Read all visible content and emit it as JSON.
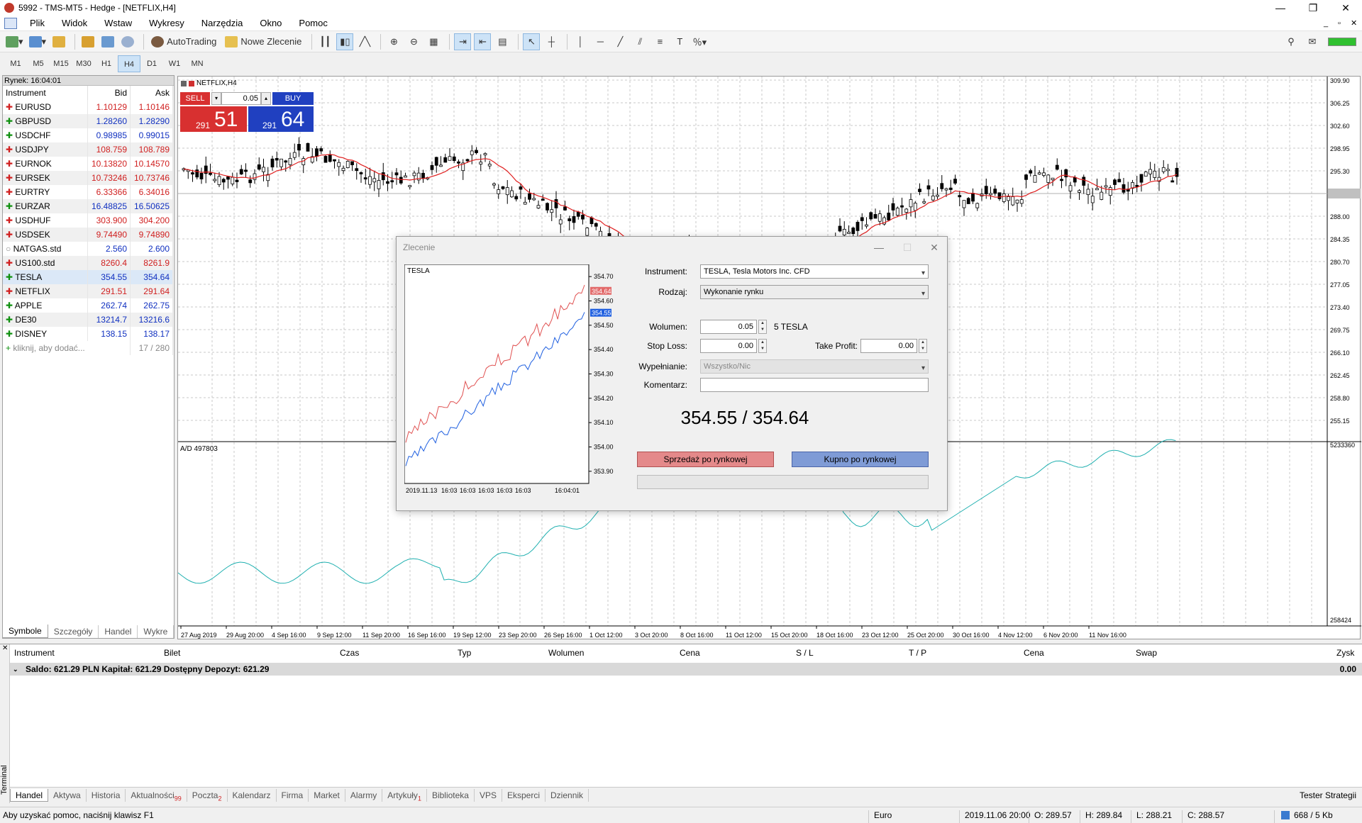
{
  "window": {
    "title": "5992 - TMS-MT5 - Hedge - [NETFLIX,H4]",
    "controls": [
      "—",
      "❐",
      "✕"
    ],
    "mdi_controls": [
      "_",
      "▫",
      "✕"
    ]
  },
  "menu": [
    "Plik",
    "Widok",
    "Wstaw",
    "Wykresy",
    "Narzędzia",
    "Okno",
    "Pomoc"
  ],
  "toolbar": {
    "autotrading": "AutoTrading",
    "new_order": "Nowe Zlecenie"
  },
  "timeframes": {
    "items": [
      "M1",
      "M5",
      "M15",
      "M30",
      "H1",
      "H4",
      "D1",
      "W1",
      "MN"
    ],
    "selected": "H4"
  },
  "market_watch": {
    "title": "Rynek: 16:04:01",
    "columns": [
      "Instrument",
      "Bid",
      "Ask"
    ],
    "rows": [
      {
        "symbol": "EURUSD",
        "bid": "1.10129",
        "ask": "1.10146",
        "dir": "down"
      },
      {
        "symbol": "GBPUSD",
        "bid": "1.28260",
        "ask": "1.28290",
        "dir": "up"
      },
      {
        "symbol": "USDCHF",
        "bid": "0.98985",
        "ask": "0.99015",
        "dir": "up"
      },
      {
        "symbol": "USDJPY",
        "bid": "108.759",
        "ask": "108.789",
        "dir": "down"
      },
      {
        "symbol": "EURNOK",
        "bid": "10.13820",
        "ask": "10.14570",
        "dir": "down"
      },
      {
        "symbol": "EURSEK",
        "bid": "10.73246",
        "ask": "10.73746",
        "dir": "down"
      },
      {
        "symbol": "EURTRY",
        "bid": "6.33366",
        "ask": "6.34016",
        "dir": "down"
      },
      {
        "symbol": "EURZAR",
        "bid": "16.48825",
        "ask": "16.50625",
        "dir": "up"
      },
      {
        "symbol": "USDHUF",
        "bid": "303.900",
        "ask": "304.200",
        "dir": "down"
      },
      {
        "symbol": "USDSEK",
        "bid": "9.74490",
        "ask": "9.74890",
        "dir": "down"
      },
      {
        "symbol": "NATGAS.std",
        "bid": "2.560",
        "ask": "2.600",
        "dir": "none"
      },
      {
        "symbol": "US100.std",
        "bid": "8260.4",
        "ask": "8261.9",
        "dir": "down"
      },
      {
        "symbol": "TESLA",
        "bid": "354.55",
        "ask": "354.64",
        "dir": "up"
      },
      {
        "symbol": "NETFLIX",
        "bid": "291.51",
        "ask": "291.64",
        "dir": "down"
      },
      {
        "symbol": "APPLE",
        "bid": "262.74",
        "ask": "262.75",
        "dir": "up"
      },
      {
        "symbol": "DE30",
        "bid": "13214.7",
        "ask": "13216.6",
        "dir": "up"
      },
      {
        "symbol": "DISNEY",
        "bid": "138.15",
        "ask": "138.17",
        "dir": "up"
      }
    ],
    "add_label": "kliknij, aby dodać...",
    "count": "17 / 280",
    "tabs": [
      "Symbole",
      "Szczegóły",
      "Handel",
      "Wykre"
    ]
  },
  "chart": {
    "label": "NETFLIX,H4",
    "oneclick": {
      "sell": "SELL",
      "buy": "BUY",
      "volume": "0.05",
      "sell_big": "51",
      "sell_small": "291",
      "buy_big": "64",
      "buy_small": "291"
    },
    "price_ticks": [
      "309.90",
      "306.25",
      "302.60",
      "298.95",
      "295.30",
      "291.51",
      "288.00",
      "284.35",
      "280.70",
      "277.05",
      "273.40",
      "269.75",
      "266.10",
      "262.45",
      "258.80",
      "255.15"
    ],
    "indicator_label": "A/D 497803",
    "indicator_ticks": [
      "5233360",
      "258424"
    ],
    "time_ticks": [
      "27 Aug 2019",
      "29 Aug 20:00",
      "4 Sep 16:00",
      "9 Sep 12:00",
      "11 Sep 20:00",
      "16 Sep 16:00",
      "19 Sep 12:00",
      "23 Sep 20:00",
      "26 Sep 16:00",
      "1 Oct 12:00",
      "3 Oct 20:00",
      "8 Oct 16:00",
      "11 Oct 12:00",
      "15 Oct 20:00",
      "18 Oct 16:00",
      "23 Oct 12:00",
      "25 Oct 20:00",
      "30 Oct 16:00",
      "4 Nov 12:00",
      "6 Nov 20:00",
      "11 Nov 16:00"
    ],
    "colors": {
      "bull": "#000000",
      "bear": "#000000",
      "ma": "#e02020",
      "ad": "#20b0b0"
    }
  },
  "dialog": {
    "title": "Zlecenie",
    "mini_chart": {
      "symbol": "TESLA",
      "ticks": [
        "354.70",
        "354.60",
        "354.50",
        "354.40",
        "354.30",
        "354.20",
        "354.10",
        "354.00",
        "353.90"
      ],
      "ask_tag": "354.64",
      "bid_tag": "354.55",
      "time_labels": [
        "2019.11.13",
        "16:03",
        "16:03",
        "16:03",
        "16:03",
        "16:03",
        "16:04:01"
      ]
    },
    "instrument_label": "Instrument:",
    "instrument_value": "TESLA, Tesla Motors Inc. CFD",
    "type_label": "Rodzaj:",
    "type_value": "Wykonanie rynku",
    "volume_label": "Wolumen:",
    "volume_value": "0.05",
    "volume_unit": "5 TESLA",
    "sl_label": "Stop Loss:",
    "sl_value": "0.00",
    "tp_label": "Take Profit:",
    "tp_value": "0.00",
    "fill_label": "Wypełnianie:",
    "fill_value": "Wszystko/Nic",
    "comment_label": "Komentarz:",
    "comment_value": "",
    "price": "354.55 / 354.64",
    "sell_button": "Sprzedaż po rynkowej",
    "buy_button": "Kupno po rynkowej"
  },
  "terminal": {
    "side_label": "Terminal",
    "columns": [
      "Instrument",
      "Bilet",
      "Czas",
      "Typ",
      "Wolumen",
      "Cena",
      "S / L",
      "T / P",
      "Cena",
      "Swap",
      "Zysk"
    ],
    "balance": "Saldo: 621.29 PLN  Kapitał: 621.29  Dostępny Depozyt: 621.29",
    "balance_profit": "0.00",
    "tabs": [
      {
        "label": "Handel",
        "badge": ""
      },
      {
        "label": "Aktywa",
        "badge": ""
      },
      {
        "label": "Historia",
        "badge": ""
      },
      {
        "label": "Aktualności",
        "badge": "99"
      },
      {
        "label": "Poczta",
        "badge": "2"
      },
      {
        "label": "Kalendarz",
        "badge": ""
      },
      {
        "label": "Firma",
        "badge": ""
      },
      {
        "label": "Market",
        "badge": ""
      },
      {
        "label": "Alarmy",
        "badge": ""
      },
      {
        "label": "Artykuły",
        "badge": "1"
      },
      {
        "label": "Biblioteka",
        "badge": ""
      },
      {
        "label": "VPS",
        "badge": ""
      },
      {
        "label": "Eksperci",
        "badge": ""
      },
      {
        "label": "Dziennik",
        "badge": ""
      }
    ],
    "tester": "Tester Strategii"
  },
  "status": {
    "help": "Aby uzyskać pomoc, naciśnij klawisz F1",
    "profile": "Euro",
    "time": "2019.11.06 20:00",
    "open": "O: 289.57",
    "high": "H: 289.84",
    "low": "L: 288.21",
    "close": "C: 288.57",
    "traffic": "668 / 5 Kb"
  }
}
